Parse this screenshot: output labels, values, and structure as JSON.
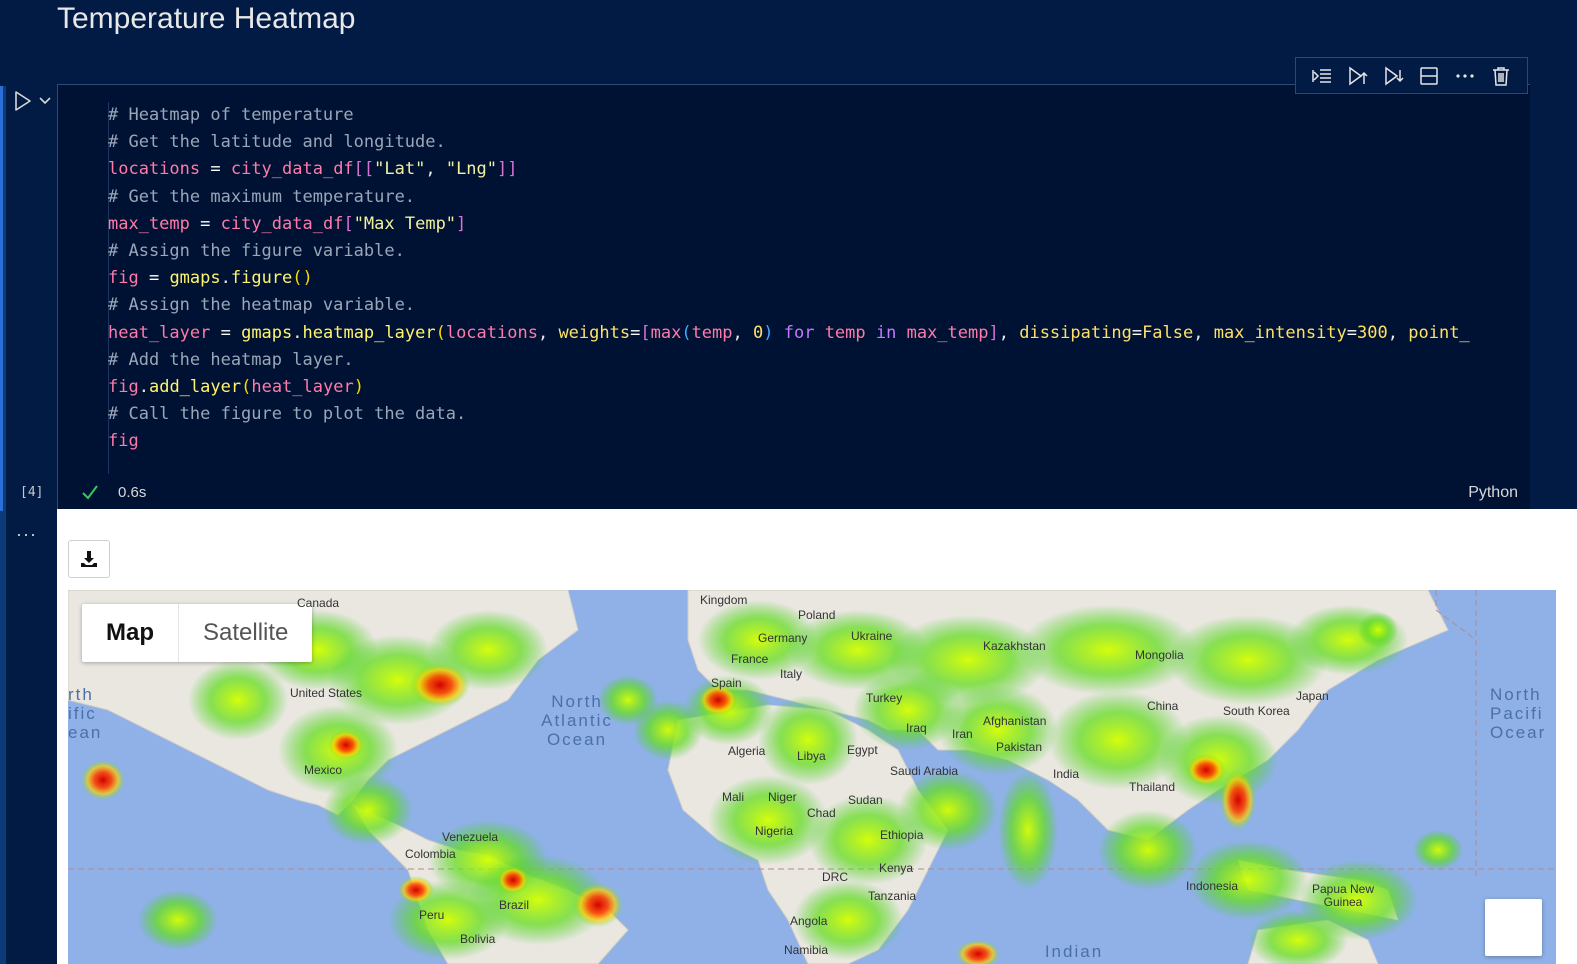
{
  "heading": "Temperature Heatmap",
  "cell": {
    "execution_count": "[4]",
    "duration": "0.6s",
    "language": "Python",
    "toolbar": [
      "execute-above-icon",
      "run-above-icon",
      "run-below-icon",
      "split-cell-icon",
      "more-icon",
      "delete-icon"
    ]
  },
  "code": [
    [
      [
        "c-cm",
        "# Heatmap of temperature"
      ]
    ],
    [
      [
        "c-cm",
        "# Get the latitude and longitude."
      ]
    ],
    [
      [
        "c-var",
        "locations"
      ],
      [
        "c-op",
        " = "
      ],
      [
        "c-var",
        "city_data_df"
      ],
      [
        "c-br2",
        "[["
      ],
      [
        "c-str",
        "\"Lat\""
      ],
      [
        "c-plain",
        ", "
      ],
      [
        "c-str",
        "\"Lng\""
      ],
      [
        "c-br2",
        "]]"
      ]
    ],
    [
      [
        "c-cm",
        "# Get the maximum temperature."
      ]
    ],
    [
      [
        "c-var",
        "max_temp"
      ],
      [
        "c-op",
        " = "
      ],
      [
        "c-var",
        "city_data_df"
      ],
      [
        "c-br2",
        "["
      ],
      [
        "c-str",
        "\"Max Temp\""
      ],
      [
        "c-br2",
        "]"
      ]
    ],
    [
      [
        "c-cm",
        "# Assign the figure variable."
      ]
    ],
    [
      [
        "c-var",
        "fig"
      ],
      [
        "c-op",
        " = "
      ],
      [
        "c-fn",
        "gmaps"
      ],
      [
        "c-plain",
        "."
      ],
      [
        "c-fn",
        "figure"
      ],
      [
        "c-br1",
        "()"
      ]
    ],
    [
      [
        "c-cm",
        "# Assign the heatmap variable."
      ]
    ],
    [
      [
        "c-var",
        "heat_layer"
      ],
      [
        "c-op",
        " = "
      ],
      [
        "c-fn",
        "gmaps"
      ],
      [
        "c-plain",
        "."
      ],
      [
        "c-fn",
        "heatmap_layer"
      ],
      [
        "c-br1",
        "("
      ],
      [
        "c-var",
        "locations"
      ],
      [
        "c-plain",
        ", "
      ],
      [
        "c-num",
        "weights"
      ],
      [
        "c-op",
        "="
      ],
      [
        "c-br2",
        "["
      ],
      [
        "c-var",
        "max"
      ],
      [
        "c-br3",
        "("
      ],
      [
        "c-var",
        "temp"
      ],
      [
        "c-plain",
        ", "
      ],
      [
        "c-num",
        "0"
      ],
      [
        "c-br3",
        ")"
      ],
      [
        "c-kw",
        " for "
      ],
      [
        "c-var",
        "temp"
      ],
      [
        "c-kw",
        " in "
      ],
      [
        "c-var",
        "max_temp"
      ],
      [
        "c-br2",
        "]"
      ],
      [
        "c-plain",
        ", "
      ],
      [
        "c-num",
        "dissipating"
      ],
      [
        "c-op",
        "="
      ],
      [
        "c-num",
        "False"
      ],
      [
        "c-plain",
        ", "
      ],
      [
        "c-num",
        "max_intensity"
      ],
      [
        "c-op",
        "="
      ],
      [
        "c-num",
        "300"
      ],
      [
        "c-plain",
        ", "
      ],
      [
        "c-num",
        "point_"
      ]
    ],
    [
      [
        "c-cm",
        "# Add the heatmap layer."
      ]
    ],
    [
      [
        "c-var",
        "fig"
      ],
      [
        "c-plain",
        "."
      ],
      [
        "c-fn",
        "add_layer"
      ],
      [
        "c-br1",
        "("
      ],
      [
        "c-var",
        "heat_layer"
      ],
      [
        "c-br1",
        ")"
      ]
    ],
    [
      [
        "c-cm",
        "# Call the figure to plot the data."
      ]
    ],
    [
      [
        "c-var",
        "fig"
      ]
    ]
  ],
  "output": {
    "download_icon": "download-icon",
    "map_type": {
      "map": "Map",
      "satellite": "Satellite",
      "selected": "Map"
    },
    "labels": {
      "canada": "Canada",
      "kingdom": "Kingdom",
      "poland": "Poland",
      "germany": "Germany",
      "ukraine": "Ukraine",
      "kazakhstan": "Kazakhstan",
      "mongolia": "Mongolia",
      "france": "France",
      "italy": "Italy",
      "spain": "Spain",
      "united_states": "United States",
      "turkey": "Turkey",
      "china": "China",
      "south_korea": "South Korea",
      "japan": "Japan",
      "iraq": "Iraq",
      "afghanistan": "Afghanistan",
      "iran": "Iran",
      "pakistan": "Pakistan",
      "algeria": "Algeria",
      "libya": "Libya",
      "egypt": "Egypt",
      "saudi_arabia": "Saudi Arabia",
      "india": "India",
      "mexico": "Mexico",
      "mali": "Mali",
      "niger": "Niger",
      "sudan": "Sudan",
      "thailand": "Thailand",
      "chad": "Chad",
      "nigeria": "Nigeria",
      "ethiopia": "Ethiopia",
      "venezuela": "Venezuela",
      "colombia": "Colombia",
      "kenya": "Kenya",
      "drc": "DRC",
      "indonesia": "Indonesia",
      "papua": "Papua New\nGuinea",
      "tanzania": "Tanzania",
      "brazil": "Brazil",
      "peru": "Peru",
      "angola": "Angola",
      "bolivia": "Bolivia",
      "namibia": "Namibia"
    },
    "oceans": {
      "north_atlantic": "North\nAtlantic\nOcean",
      "north_pacific_left": "rth\nific\nean",
      "north_pacific_right": "North\nPacifi\nOcear",
      "indian": "Indian"
    }
  }
}
